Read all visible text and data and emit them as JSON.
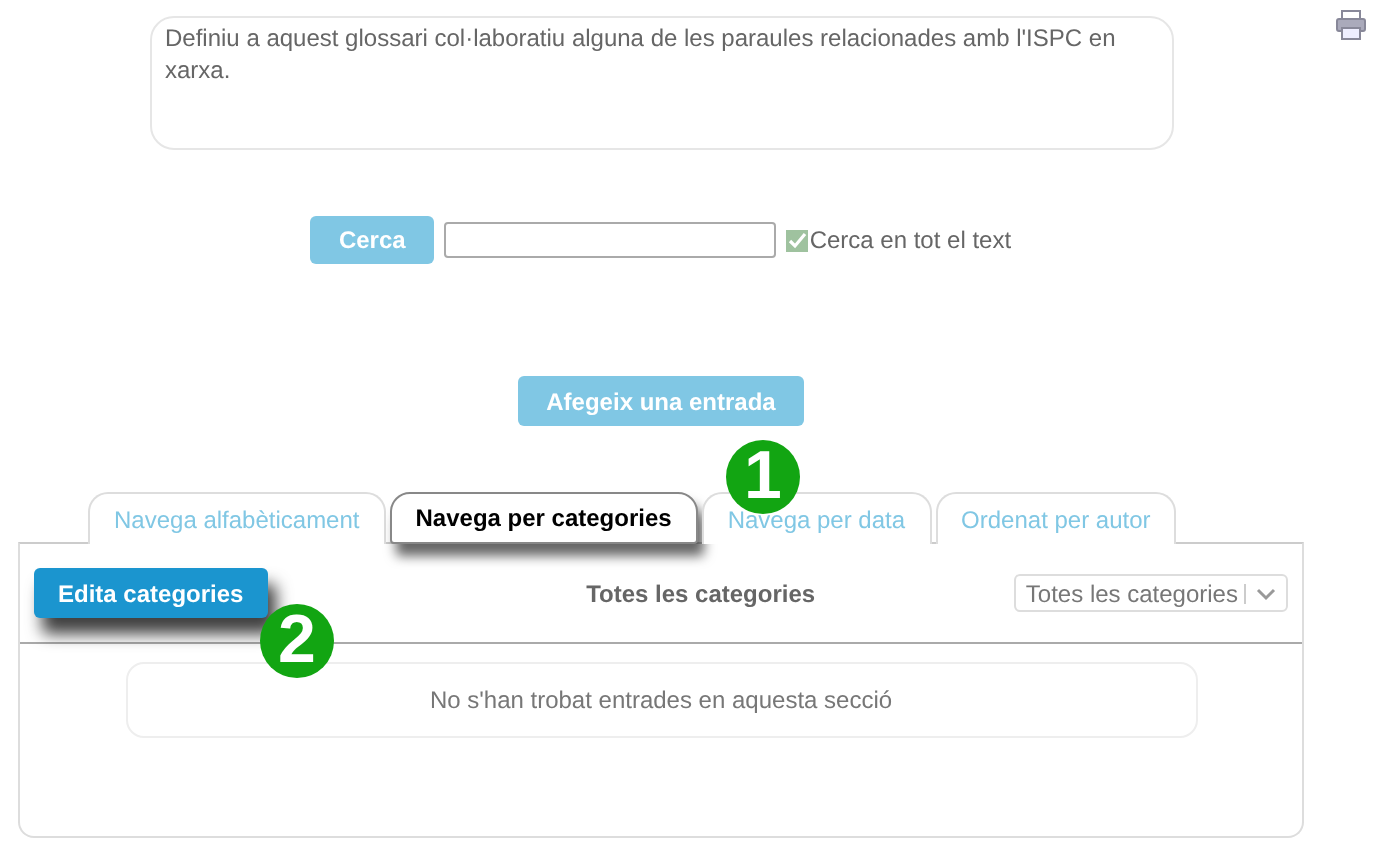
{
  "description": "Definiu a aquest glossari col·laboratiu alguna de les paraules relacionades amb l'ISPC en xarxa.",
  "search": {
    "button": "Cerca",
    "full_text": {
      "label": "Cerca en tot el text",
      "checked": true
    }
  },
  "add_button": "Afegeix una entrada",
  "tabs": [
    {
      "label": "Navega alfabèticament",
      "selected": false
    },
    {
      "label": "Navega per categories",
      "selected": true
    },
    {
      "label": "Navega per data",
      "selected": false
    },
    {
      "label": "Ordenat per autor",
      "selected": false
    }
  ],
  "panel": {
    "edit_button": "Edita categories",
    "heading": "Totes les categories",
    "category_select": "Totes les categories",
    "empty_message": "No s'han trobat entrades en aquesta secció"
  },
  "callouts": [
    {
      "label": "1"
    },
    {
      "label": "2"
    }
  ]
}
